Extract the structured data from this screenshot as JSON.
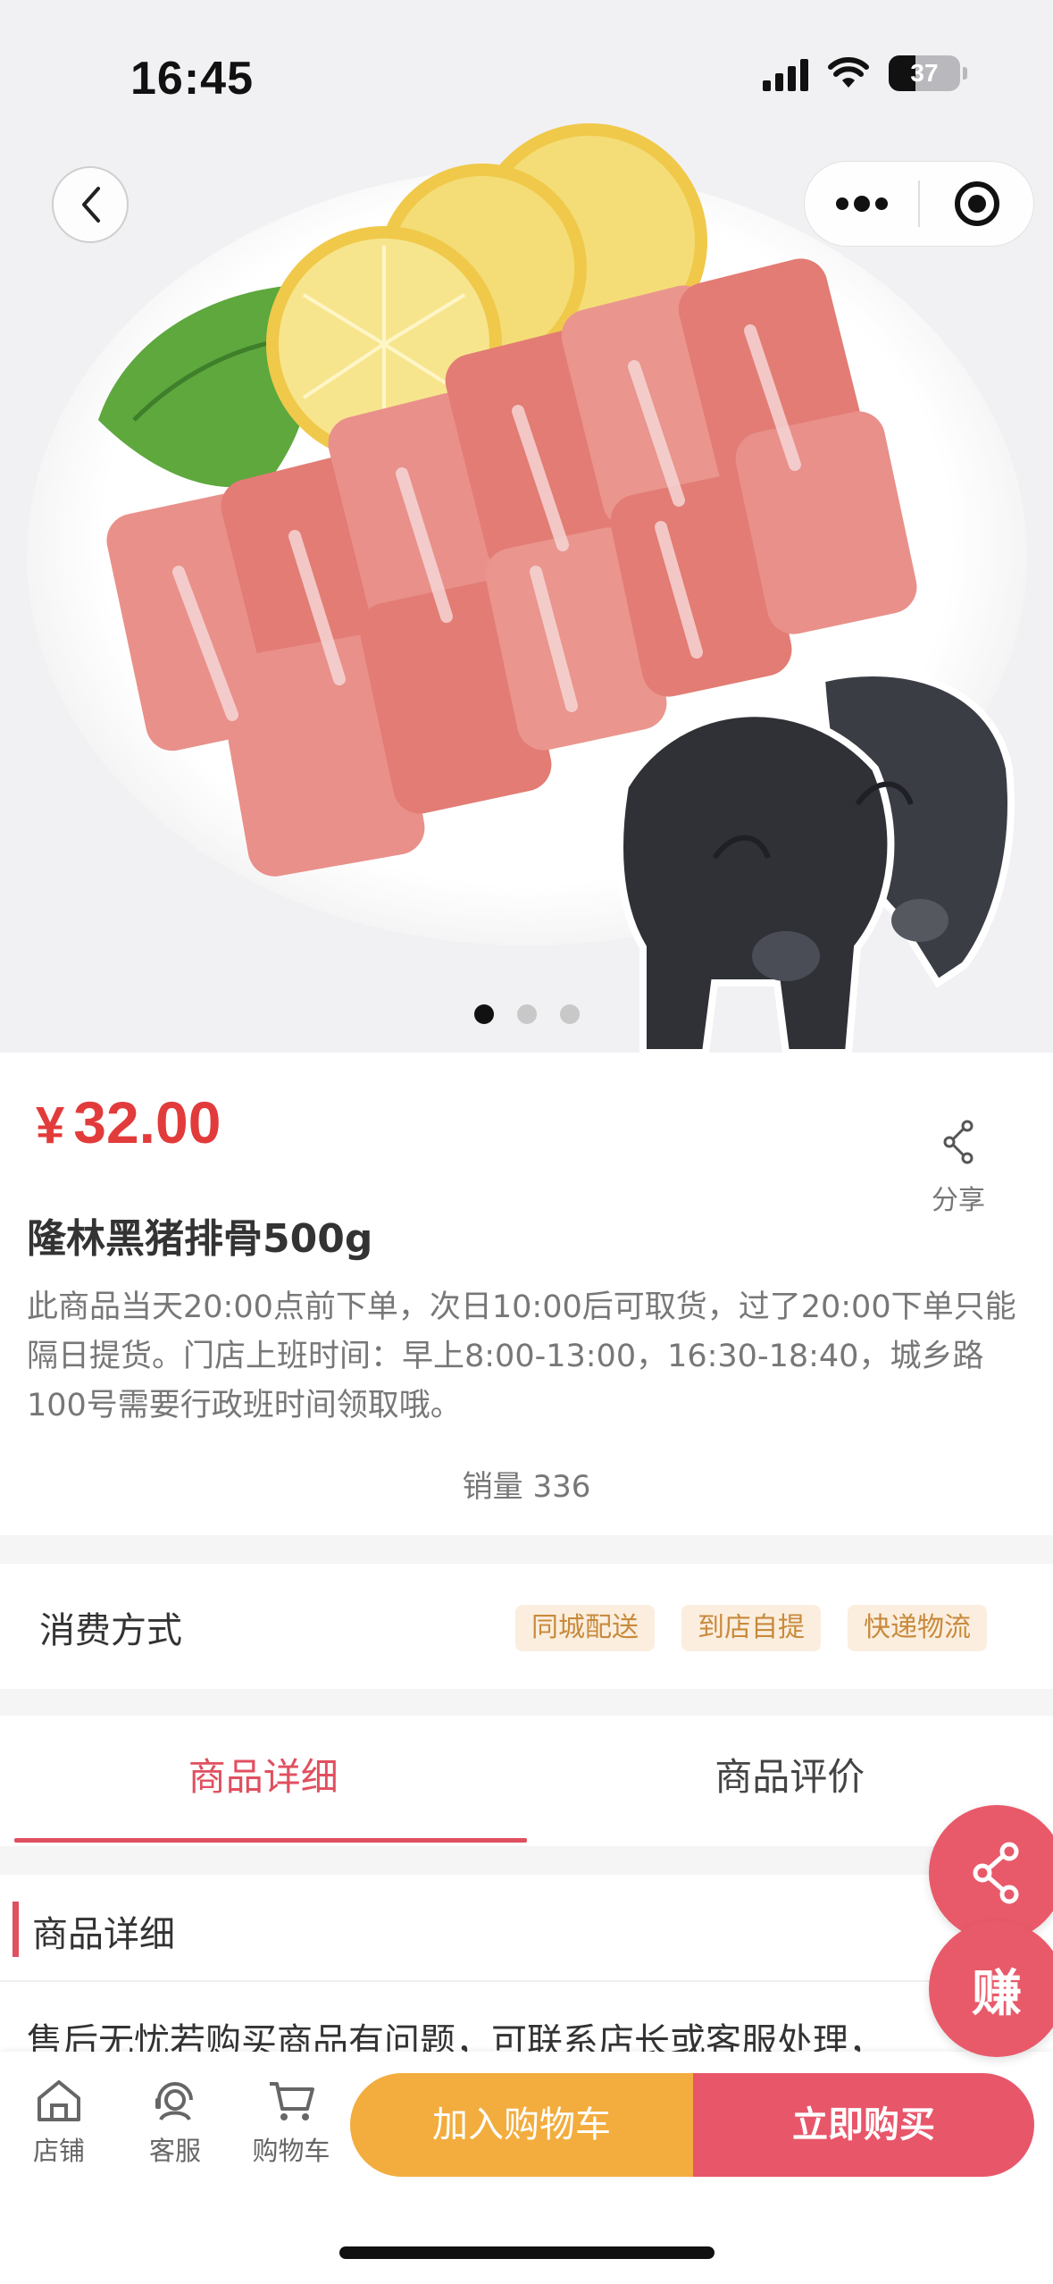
{
  "status_bar": {
    "time": "16:45",
    "battery": "37",
    "battery_level": 0.37
  },
  "carousel": {
    "slides": 3,
    "active_index": 0
  },
  "product": {
    "currency": "¥",
    "price": "32.00",
    "title": "隆林黑猪排骨500g",
    "description": "此商品当天20:00点前下单，次日10:00后可取货，过了20:00下单只能隔日提货。门店上班时间：早上8:00-13:00，16:30-18:40，城乡路100号需要行政班时间领取哦。",
    "sales_label": "销量 336",
    "share_label": "分享"
  },
  "consumption": {
    "label": "消费方式",
    "tags": [
      "同城配送",
      "到店自提",
      "快递物流"
    ]
  },
  "tabs": [
    {
      "label": "商品详细",
      "active": true
    },
    {
      "label": "商品评价",
      "active": false
    }
  ],
  "detail": {
    "heading": "商品详细",
    "text": "售后无忧若购买商品有问题，可联系店长或客服处理，"
  },
  "floating": {
    "earn_label": "赚"
  },
  "bottom_bar": {
    "nav": [
      {
        "label": "店铺",
        "icon": "store-icon"
      },
      {
        "label": "客服",
        "icon": "customer-service-icon"
      },
      {
        "label": "购物车",
        "icon": "cart-icon"
      }
    ],
    "add_to_cart": "加入购物车",
    "buy_now": "立即购买"
  },
  "colors": {
    "price": "#e23b3b",
    "accent": "#e05060",
    "cart_button": "#f2ad3e",
    "buy_button": "#e8566a",
    "tag_bg": "#fbeede",
    "tag_text": "#c88a3c"
  }
}
